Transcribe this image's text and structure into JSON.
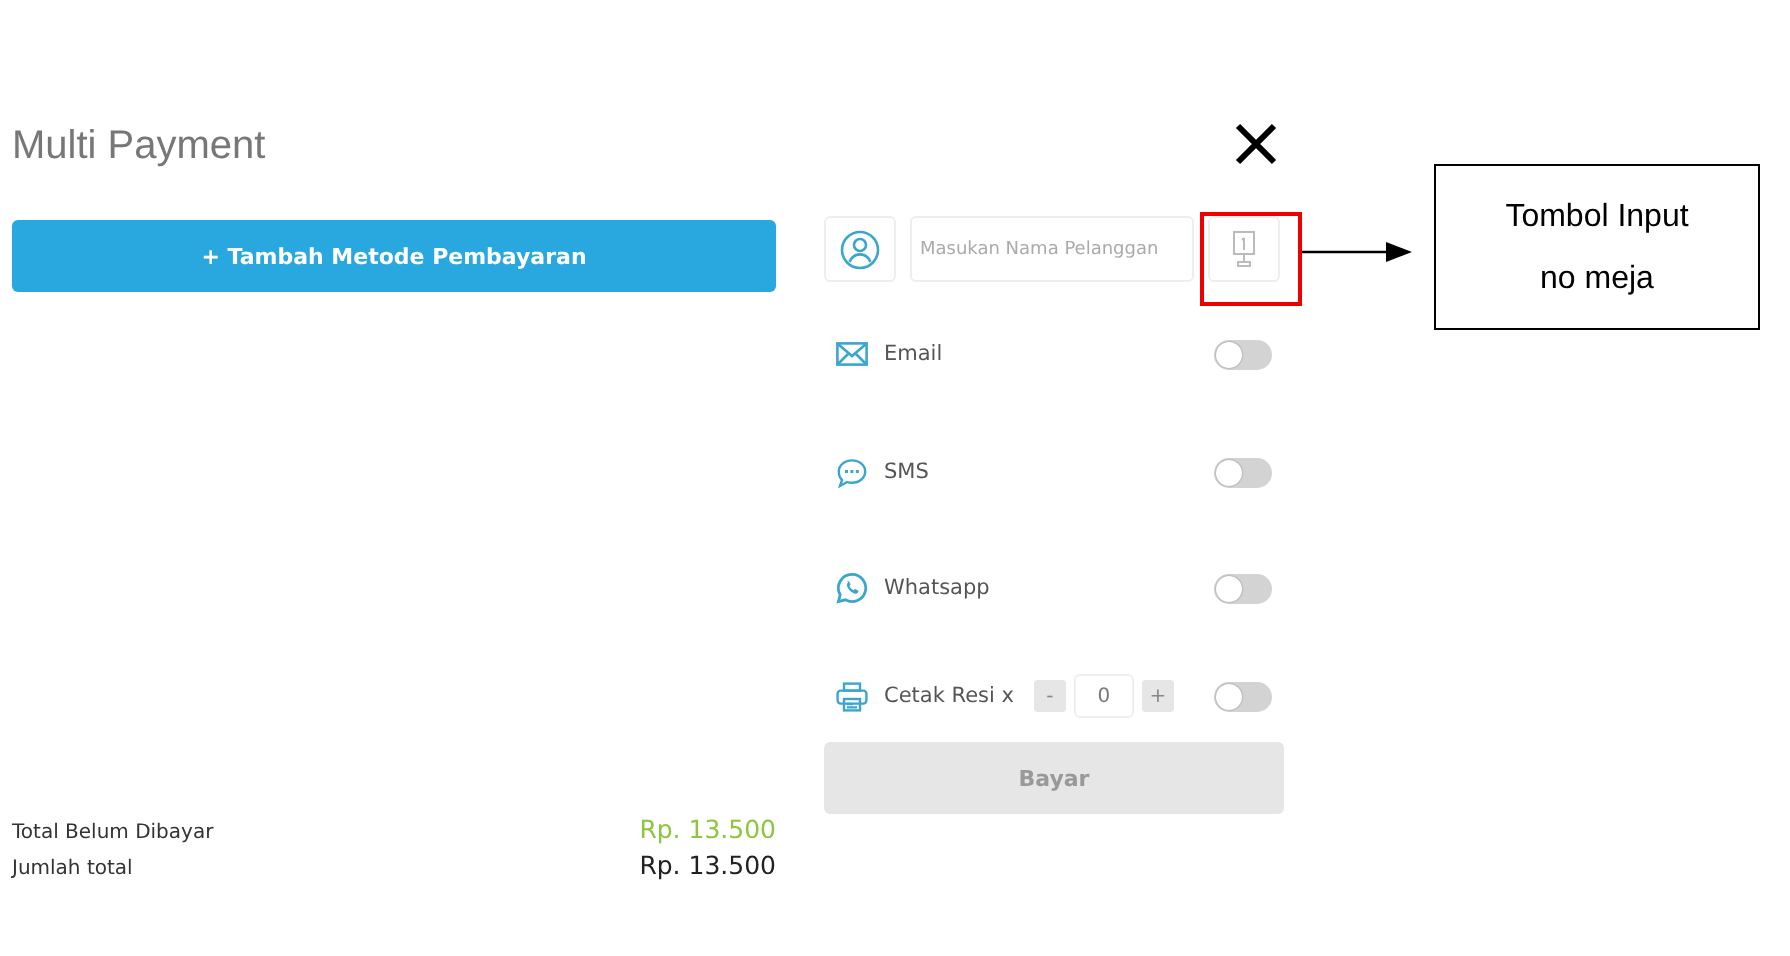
{
  "title": "Multi Payment",
  "add_method_button": "+ Tambah Metode Pembayaran",
  "customer": {
    "placeholder": "Masukan Nama Pelanggan"
  },
  "channels": [
    {
      "kind": "email",
      "label": "Email",
      "on": false
    },
    {
      "kind": "sms",
      "label": "SMS",
      "on": false
    },
    {
      "kind": "whatsapp",
      "label": "Whatsapp",
      "on": false
    },
    {
      "kind": "print",
      "label": "Cetak Resi x",
      "on": false,
      "minus": "-",
      "count": "0",
      "plus": "+"
    }
  ],
  "pay_button": {
    "label": "Bayar",
    "disabled": true
  },
  "totals": [
    {
      "label": "Total Belum Dibayar",
      "value": "Rp. 13.500",
      "kind": "due"
    },
    {
      "label": "Jumlah total",
      "value": "Rp. 13.500",
      "kind": "total"
    }
  ],
  "annotation": {
    "text": "Tombol Input no meja"
  }
}
